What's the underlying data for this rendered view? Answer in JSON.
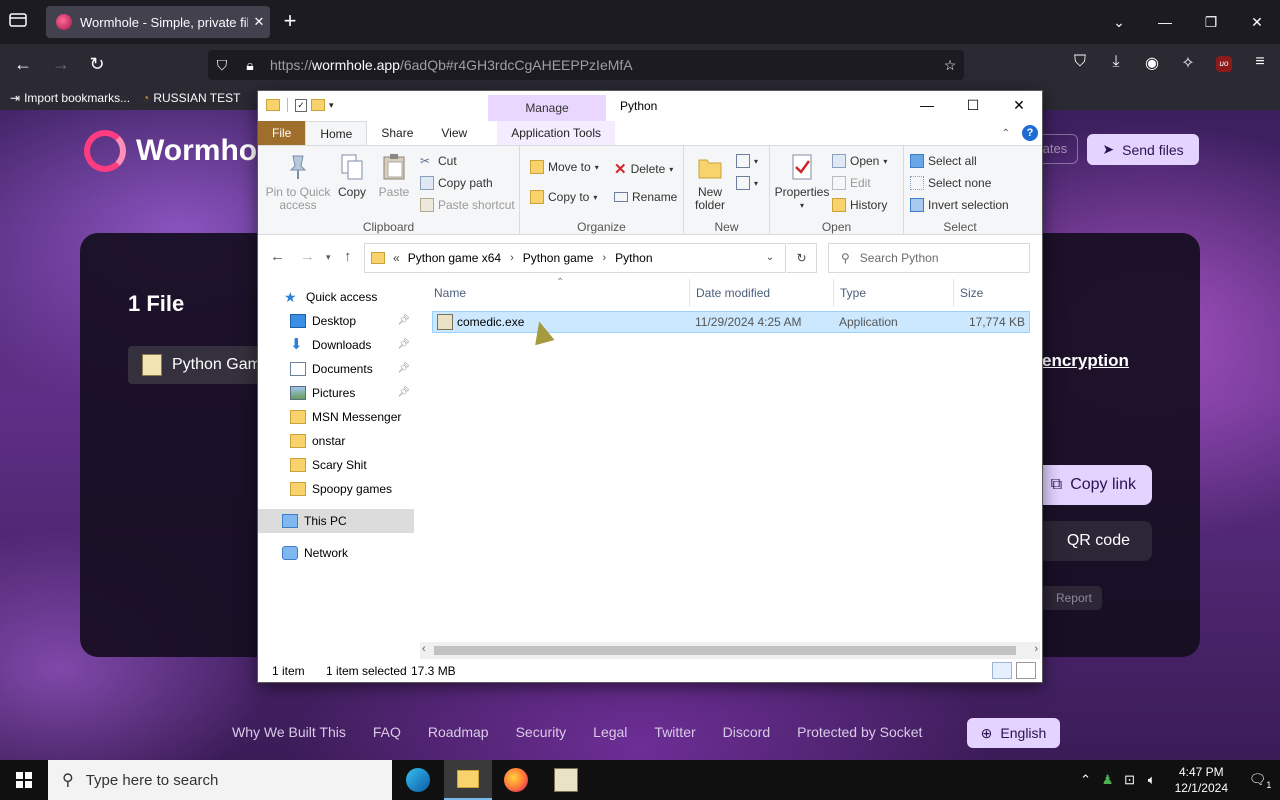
{
  "browser": {
    "tab_title": "Wormhole - Simple, private file",
    "url_host": "wormhole.app",
    "url_rest": "/6adQb#r4GH3rdcCgAHEEPPzIeMfA",
    "url_scheme": "https://",
    "bookmarks": [
      {
        "label": "Import bookmarks...",
        "icon": "import-icon"
      },
      {
        "label": "RUSSIAN TEST",
        "icon": "globe-icon"
      }
    ]
  },
  "page": {
    "logo_text": "Wormhole",
    "updates_label": "ates",
    "send_files_label": "Send files",
    "card_title": "1 File",
    "file_pill_label": "Python Gam",
    "encryption_text": "encryption",
    "copy_link_label": "Copy link",
    "qr_code_label": "QR code",
    "report_label": "Report",
    "footer_links": [
      "Why We Built This",
      "FAQ",
      "Roadmap",
      "Security",
      "Legal",
      "Twitter",
      "Discord",
      "Protected by Socket"
    ],
    "language_label": "English"
  },
  "explorer": {
    "context_tab": "Manage",
    "window_title": "Python",
    "ribbon_tabs": [
      "File",
      "Home",
      "Share",
      "View",
      "Application Tools"
    ],
    "clipboard": {
      "pin_label": "Pin to Quick access",
      "copy_label": "Copy",
      "paste_label": "Paste",
      "cut_label": "Cut",
      "copy_path_label": "Copy path",
      "paste_shortcut_label": "Paste shortcut",
      "group_label": "Clipboard"
    },
    "organize": {
      "move_to_label": "Move to",
      "copy_to_label": "Copy to",
      "delete_label": "Delete",
      "rename_label": "Rename",
      "group_label": "Organize"
    },
    "new": {
      "new_folder_label": "New folder",
      "group_label": "New"
    },
    "open": {
      "properties_label": "Properties",
      "open_label": "Open",
      "edit_label": "Edit",
      "history_label": "History",
      "group_label": "Open"
    },
    "select": {
      "select_all_label": "Select all",
      "select_none_label": "Select none",
      "invert_label": "Invert selection",
      "group_label": "Select"
    },
    "breadcrumb": [
      "Python game x64",
      "Python game",
      "Python"
    ],
    "breadcrumb_prefix": "«",
    "search_placeholder": "Search Python",
    "nav_items": [
      {
        "label": "Quick access",
        "icon": "star-icon"
      },
      {
        "label": "Desktop",
        "icon": "desktop-icon"
      },
      {
        "label": "Downloads",
        "icon": "download-icon"
      },
      {
        "label": "Documents",
        "icon": "document-icon"
      },
      {
        "label": "Pictures",
        "icon": "picture-icon"
      },
      {
        "label": "MSN Messenger",
        "icon": "folder-icon"
      },
      {
        "label": "onstar",
        "icon": "folder-icon"
      },
      {
        "label": "Scary Shit",
        "icon": "folder-icon"
      },
      {
        "label": "Spoopy games",
        "icon": "folder-icon"
      },
      {
        "label": "This PC",
        "icon": "computer-icon"
      },
      {
        "label": "Network",
        "icon": "network-icon"
      }
    ],
    "columns": [
      "Name",
      "Date modified",
      "Type",
      "Size"
    ],
    "files": [
      {
        "name": "comedic.exe",
        "date": "11/29/2024 4:25 AM",
        "type": "Application",
        "size": "17,774 KB"
      }
    ],
    "status": {
      "count": "1 item",
      "selected": "1 item selected",
      "size": "17.3 MB"
    }
  },
  "taskbar": {
    "search_placeholder": "Type here to search",
    "time": "4:47 PM",
    "date": "12/1/2024",
    "notification_count": "1"
  },
  "colors": {
    "accent_lilac": "#e4d2ff",
    "explorer_selection": "#cce8ff",
    "file_tab": "#9f6e2a"
  }
}
